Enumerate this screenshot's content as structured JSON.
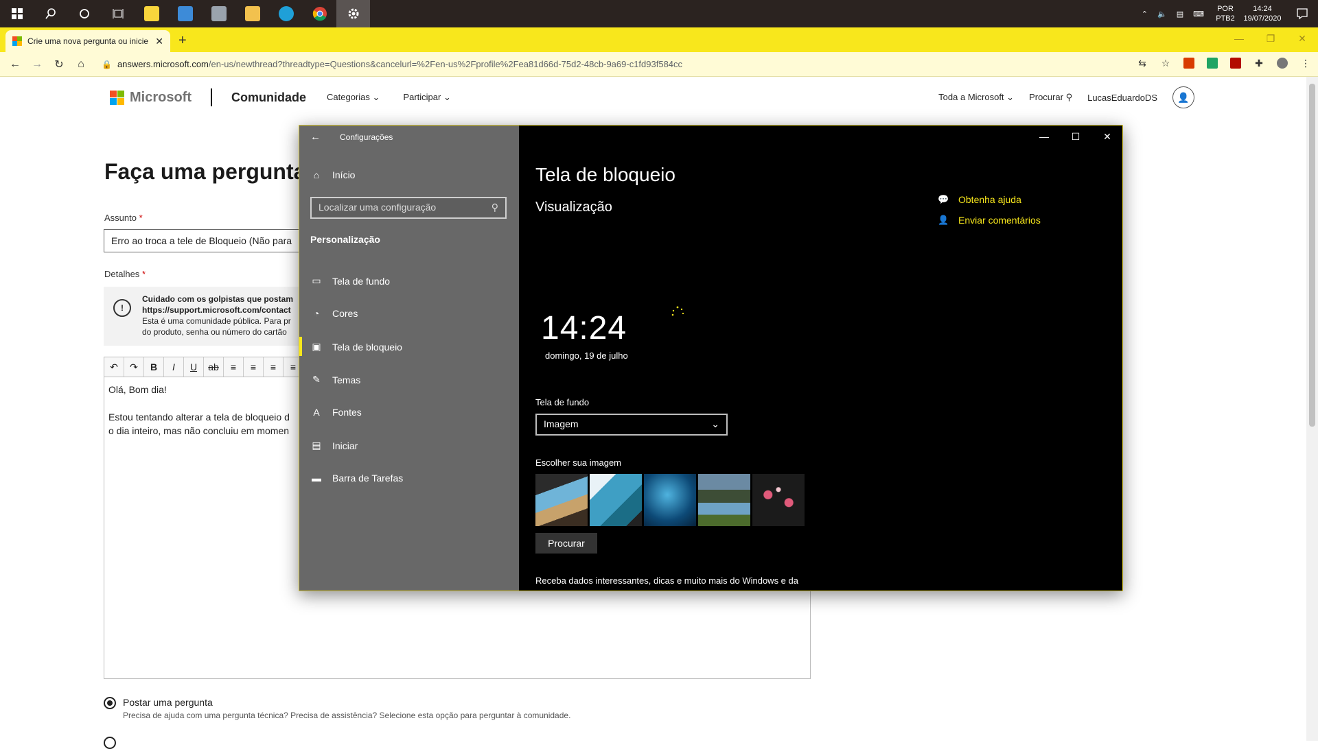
{
  "taskbar": {
    "apps": [
      "start-icon",
      "search-icon",
      "cortana-icon",
      "task-view-icon",
      "sticky-notes-icon",
      "remote-desktop-icon",
      "network-icon",
      "file-explorer-icon",
      "edge-icon",
      "chrome-icon",
      "settings-icon"
    ],
    "language": "POR",
    "layout": "PTB2",
    "time": "14:24",
    "date": "19/07/2020"
  },
  "browser": {
    "tab_title": "Crie uma nova pergunta ou inicie uma discussão",
    "url_host": "answers.microsoft.com",
    "url_path": "/en-us/newthread?threadtype=Questions&cancelurl=%2Fen-us%2Fprofile%2Fea81d66d-75d2-48cb-9a69-c1fd93f584cc"
  },
  "site": {
    "brand": "Microsoft",
    "community": "Comunidade",
    "nav_categories": "Categorias",
    "nav_participate": "Participar",
    "all_microsoft": "Toda a Microsoft",
    "search": "Procurar",
    "username": "LucasEduardoDS"
  },
  "form": {
    "title": "Faça uma pergunta",
    "subject_label": "Assunto",
    "subject_value": "Erro ao troca a tele de Bloqueio (Não para",
    "details_label": "Detalhes",
    "warning_bold_1": "Cuidado com os golpistas que postam",
    "warning_bold_2": "https://support.microsoft.com/contact",
    "warning_line_1": "Esta é uma comunidade pública. Para pr",
    "warning_line_2": "do produto, senha ou número do cartão",
    "editor_line_1": "Olá, Bom dia!",
    "editor_line_2": "Estou tentando alterar a tela de bloqueio d",
    "editor_line_3": "o dia inteiro, mas não concluiu em momen",
    "radio_title": "Postar uma pergunta",
    "radio_desc": "Precisa de ajuda com uma pergunta técnica? Precisa de assistência? Selecione esta opção para perguntar à comunidade."
  },
  "settings": {
    "app_title": "Configurações",
    "home": "Início",
    "search_placeholder": "Localizar uma configuração",
    "section": "Personalização",
    "items": [
      "Tela de fundo",
      "Cores",
      "Tela de bloqueio",
      "Temas",
      "Fontes",
      "Iniciar",
      "Barra de Tarefas"
    ],
    "page_title": "Tela de bloqueio",
    "preview_title": "Visualização",
    "help_link": "Obtenha ajuda",
    "feedback_link": "Enviar comentários",
    "preview_time": "14:24",
    "preview_date": "domingo, 19 de julho",
    "background_label": "Tela de fundo",
    "background_value": "Imagem",
    "choose_image_label": "Escolher sua imagem",
    "browse_button": "Procurar",
    "bottom_text": "Receba dados interessantes, dicas e muito mais do Windows e da"
  },
  "colors": {
    "accent": "#f8e71c",
    "sidebar": "#686868"
  }
}
